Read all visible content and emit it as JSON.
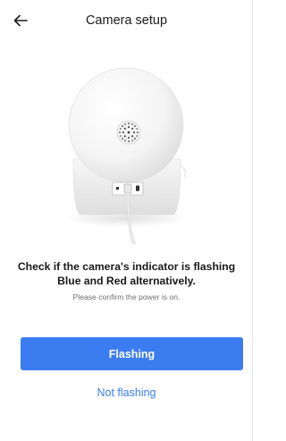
{
  "header": {
    "title": "Camera setup",
    "back_icon": "arrow-left-icon"
  },
  "illustration": {
    "subject": "camera-illustration"
  },
  "content": {
    "headline": "Check if the camera's indicator is flashing Blue and Red alternatively.",
    "subtext": "Please confirm the power is on."
  },
  "actions": {
    "primary_label": "Flashing",
    "secondary_label": "Not flashing"
  },
  "colors": {
    "accent": "#3b7cf0",
    "text": "#1a1a1a",
    "muted": "#6f6f6f"
  }
}
